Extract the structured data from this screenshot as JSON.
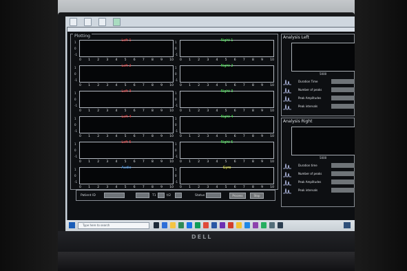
{
  "app": {
    "window_title": "",
    "plotting_label": "Plotting",
    "plots_left": [
      {
        "title": "Left 1",
        "color": "#ff3b3b"
      },
      {
        "title": "Left 2",
        "color": "#ff3b3b"
      },
      {
        "title": "Left 3",
        "color": "#ff3b3b"
      },
      {
        "title": "Left 4",
        "color": "#ff3b3b"
      },
      {
        "title": "Left 5",
        "color": "#ff3b3b"
      },
      {
        "title": "Audio",
        "color": "#4aa3ff"
      }
    ],
    "plots_right": [
      {
        "title": "Right 1",
        "color": "#4cff55"
      },
      {
        "title": "Right 2",
        "color": "#4cff55"
      },
      {
        "title": "Right 3",
        "color": "#4cff55"
      },
      {
        "title": "Right 4",
        "color": "#4cff55"
      },
      {
        "title": "Right 5",
        "color": "#4cff55"
      },
      {
        "title": "Gyro",
        "color": "#ffff3a"
      }
    ],
    "xticks": [
      "0",
      "1",
      "2",
      "3",
      "4",
      "5",
      "6",
      "7",
      "8",
      "9",
      "10"
    ],
    "yticks": [
      "1",
      "0",
      "-1"
    ],
    "bottom_bar": {
      "patient_id_label": "Patient ID",
      "t1_label": "T1",
      "t2_label": "t/2",
      "status_label": "Status",
      "process_button": "Process",
      "stop_button": "Stop"
    },
    "analysis_left": {
      "title": "Analysis Left",
      "axis_x_label": "5000",
      "rows": [
        {
          "label": "Duration Time"
        },
        {
          "label": "Number of peaks"
        },
        {
          "label": "Peak Amplitudes"
        },
        {
          "label": "Peak intervals"
        }
      ]
    },
    "analysis_right": {
      "title": "Analysis Right",
      "axis_x_label": "5000",
      "rows": [
        {
          "label": "Duration time"
        },
        {
          "label": "Number of peaks"
        },
        {
          "label": "Peak Amplitudes"
        },
        {
          "label": "Peak intervals"
        }
      ]
    },
    "taskbar": {
      "search_placeholder": "Type here to search"
    }
  },
  "device": {
    "brand": "DELL"
  },
  "colors": {
    "app_bg": "#0d0f12",
    "taskbar": "#d6dde3",
    "left_trace": "#ff3b3b",
    "right_trace": "#4cff55",
    "audio": "#4aa3ff",
    "gyro": "#ffff3a"
  }
}
